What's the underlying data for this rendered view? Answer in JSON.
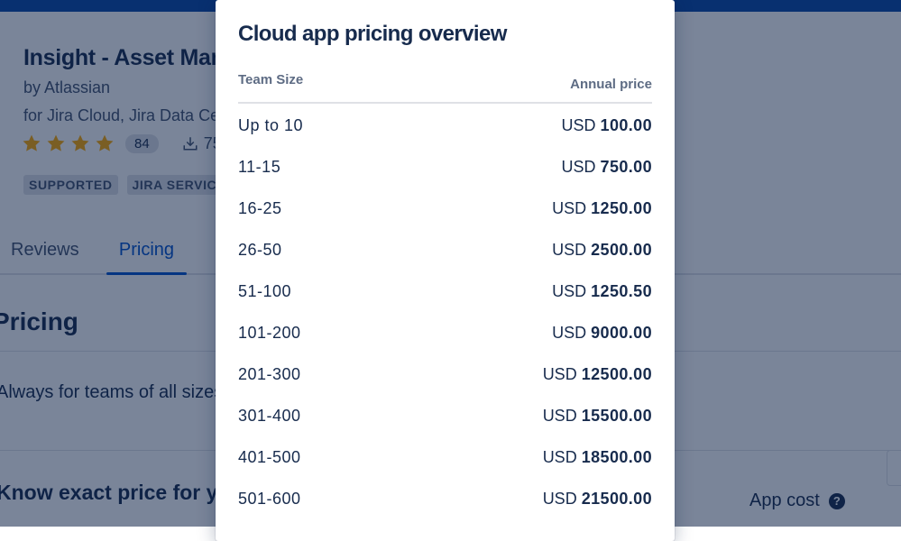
{
  "colors": {
    "brand_bar": "#0747a6",
    "primary_text": "#172b4d",
    "secondary_text": "#42526e",
    "link_active": "#0052cc",
    "star": "#ffab00",
    "overlay": "rgba(9,30,66,0.54)"
  },
  "app": {
    "title": "Insight - Asset Management",
    "vendor": "by Atlassian",
    "hosts": "for Jira Cloud, Jira Data Center",
    "rating_stars": 4,
    "review_count": "84",
    "installs_partial": "75",
    "icons": {
      "star": "star-icon",
      "installs": "download-icon"
    },
    "badges": [
      "SUPPORTED",
      "JIRA SERVICE MANAGEMENT"
    ]
  },
  "tabs": [
    {
      "label": "Reviews",
      "active": false
    },
    {
      "label": "Pricing",
      "active": true
    }
  ],
  "pricing_section": {
    "title": "Pricing",
    "description": "Always for teams of all sizes.",
    "estimate_title": "Know exact price for your team",
    "app_cost_label": "App cost",
    "help_icon": "question-circle-icon"
  },
  "modal": {
    "title": "Cloud app pricing overview",
    "columns": {
      "team_size": "Team Size",
      "annual_price": "Annual price"
    },
    "rows": [
      {
        "tier": "Up to 10",
        "currency": "USD",
        "amount": "100.00"
      },
      {
        "tier": "11-15",
        "currency": "USD",
        "amount": "750.00"
      },
      {
        "tier": "16-25",
        "currency": "USD",
        "amount": "1250.00"
      },
      {
        "tier": "26-50",
        "currency": "USD",
        "amount": "2500.00"
      },
      {
        "tier": "51-100",
        "currency": "USD",
        "amount": "1250.50"
      },
      {
        "tier": "101-200",
        "currency": "USD",
        "amount": "9000.00"
      },
      {
        "tier": "201-300",
        "currency": "USD",
        "amount": "12500.00"
      },
      {
        "tier": "301-400",
        "currency": "USD",
        "amount": "15500.00"
      },
      {
        "tier": "401-500",
        "currency": "USD",
        "amount": "18500.00"
      },
      {
        "tier": "501-600",
        "currency": "USD",
        "amount": "21500.00"
      }
    ]
  }
}
